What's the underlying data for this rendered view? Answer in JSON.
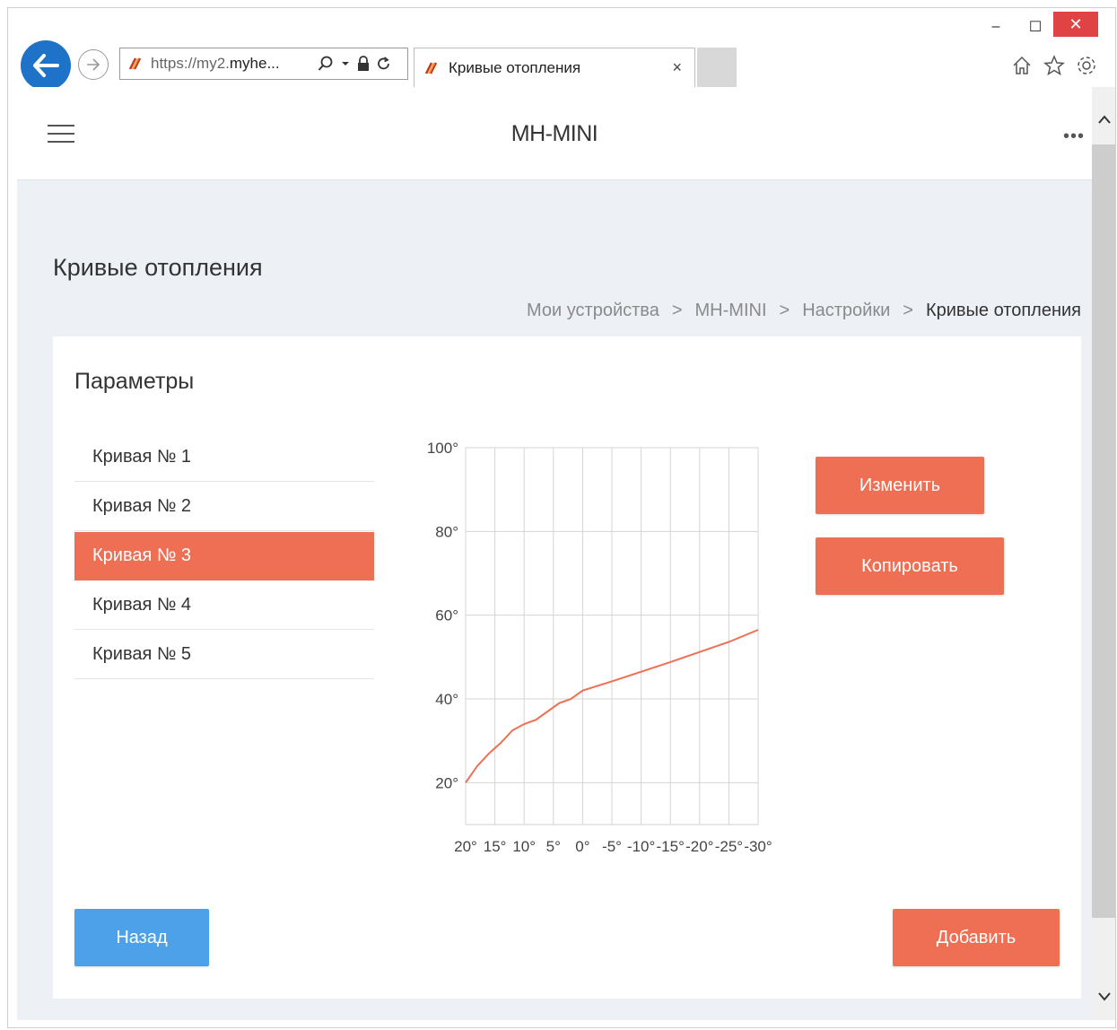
{
  "browser": {
    "address_protocol": "https://",
    "address_host_dim": "my2.",
    "address_host": "myhe...",
    "tab_title": "Кривые отопления",
    "tab_close": "×",
    "minimize": "–",
    "maximize": "☐",
    "close": "✕"
  },
  "app": {
    "title": "MH-MINI",
    "more": "•••"
  },
  "page": {
    "title": "Кривые отопления",
    "breadcrumb": [
      {
        "label": "Мои устройства"
      },
      {
        "label": "MH-MINI"
      },
      {
        "label": "Настройки"
      },
      {
        "label": "Кривые отопления"
      }
    ],
    "breadcrumb_sep": ">"
  },
  "card": {
    "title": "Параметры",
    "curves": [
      "Кривая № 1",
      "Кривая № 2",
      "Кривая № 3",
      "Кривая № 4",
      "Кривая № 5"
    ],
    "active_index": 2
  },
  "buttons": {
    "edit": "Изменить",
    "copy": "Копировать",
    "back": "Назад",
    "add": "Добавить"
  },
  "colors": {
    "accent": "#ee6f54",
    "back": "#4da1e8"
  },
  "chart_data": {
    "type": "line",
    "x_ticks": [
      "20°",
      "15°",
      "10°",
      "5°",
      "0°",
      "-5°",
      "-10°",
      "-15°",
      "-20°",
      "-25°",
      "-30°"
    ],
    "y_ticks": [
      "20°",
      "40°",
      "60°",
      "80°",
      "100°"
    ],
    "x": [
      20,
      18,
      16,
      14,
      12,
      10,
      8,
      6,
      4,
      2,
      0,
      -5,
      -10,
      -15,
      -20,
      -25,
      -30
    ],
    "y": [
      20,
      24,
      27,
      29.5,
      32.5,
      34,
      35,
      37,
      39,
      40,
      42,
      44.2,
      46.5,
      48.8,
      51.2,
      53.6,
      56.5
    ],
    "xlim": [
      20,
      -30
    ],
    "ylim": [
      10,
      100
    ],
    "grid": true,
    "line_color": "#ee6f54"
  }
}
